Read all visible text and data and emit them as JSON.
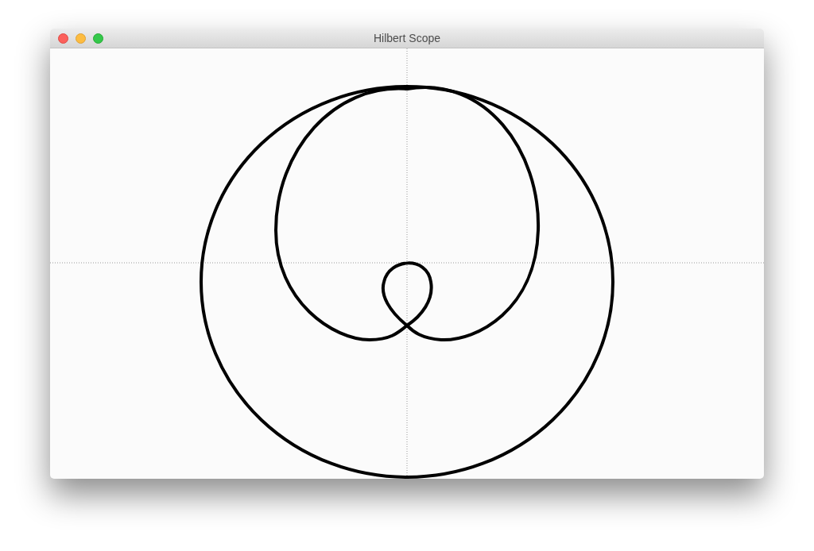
{
  "window": {
    "title": "Hilbert Scope"
  }
}
